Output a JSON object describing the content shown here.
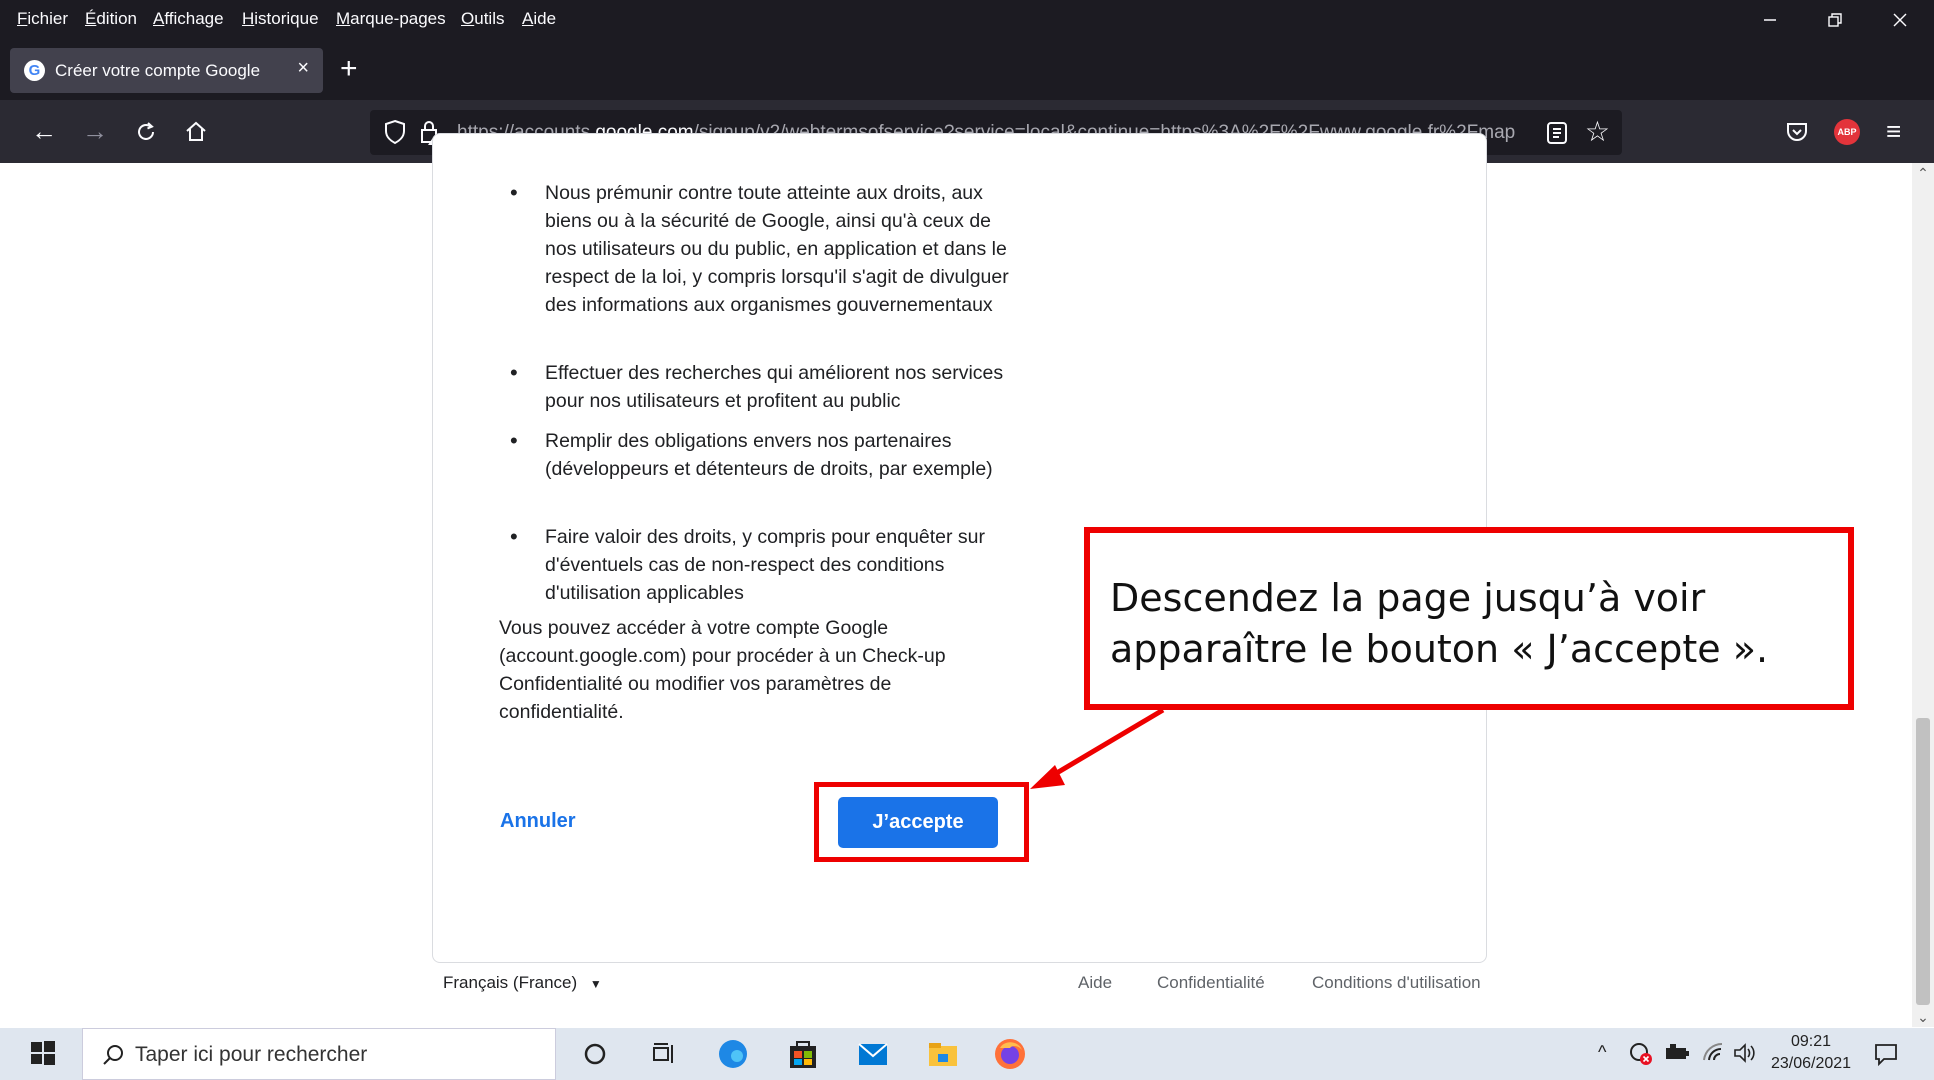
{
  "menubar": {
    "items": [
      "Fichier",
      "Édition",
      "Affichage",
      "Historique",
      "Marque-pages",
      "Outils",
      "Aide"
    ]
  },
  "tab": {
    "title": "Créer votre compte Google",
    "close": "×",
    "new_tab": "+"
  },
  "nav": {
    "back": "←",
    "forward": "→",
    "reload": "C",
    "home": "⌂",
    "url_prefix": "https://accounts.",
    "url_host": "google.com",
    "url_suffix": "/signup/v2/webtermsofservice?service=local&continue=https%3A%2F%2Fwww.google.fr%2Fmap",
    "star": "☆",
    "menu": "≡",
    "abp": "ABP"
  },
  "terms": {
    "bullets": [
      "Nous prémunir contre toute atteinte aux droits, aux biens ou à la sécurité de Google, ainsi qu'à ceux de nos utilisateurs ou du public, en application et dans le respect de la loi, y compris lorsqu'il s'agit de divulguer des informations aux organismes gouvernementaux",
      "Effectuer des recherches qui améliorent nos services pour nos utilisateurs et profitent au public",
      "Remplir des obligations envers nos partenaires (développeurs et détenteurs de droits, par exemple)",
      "Faire valoir des droits, y compris pour enquêter sur d'éventuels cas de non-respect des conditions d'utilisation applicables"
    ],
    "paragraph": "Vous pouvez accéder à votre compte Google (account.google.com) pour procéder à un Check-up Confidentialité ou modifier vos paramètres de confidentialité.",
    "cancel_label": "Annuler",
    "accept_label": "J’accepte"
  },
  "annotation": {
    "text": "Descendez la page jusqu’à voir apparaître le bouton « J’accepte ».",
    "color": "#ee0000"
  },
  "footer": {
    "language": "Français (France)",
    "links": [
      "Aide",
      "Confidentialité",
      "Conditions d'utilisation"
    ]
  },
  "taskbar": {
    "search_placeholder": "Taper ici pour rechercher",
    "time": "09:21",
    "date": "23/06/2021"
  }
}
